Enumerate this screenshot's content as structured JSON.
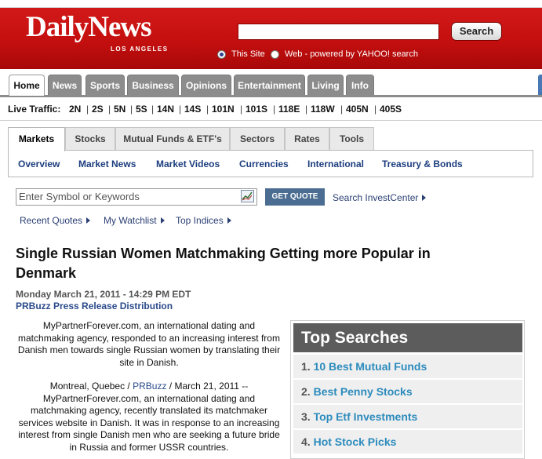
{
  "header": {
    "logo": "DailyNews",
    "logo_sub": "LOS ANGELES",
    "search_value": "",
    "search_button": "Search",
    "radio_this_site": "This Site",
    "radio_web": "Web - powered by YAHOO! search"
  },
  "nav": {
    "tabs": [
      "Home",
      "News",
      "Sports",
      "Business",
      "Opinions",
      "Entertainment",
      "Living",
      "Info"
    ],
    "active": "Home"
  },
  "traffic": {
    "label": "Live Traffic:",
    "items": [
      "2N",
      "2S",
      "5N",
      "5S",
      "14N",
      "14S",
      "101N",
      "101S",
      "118E",
      "118W",
      "405N",
      "405S"
    ]
  },
  "markets": {
    "tabs": [
      "Markets",
      "Stocks",
      "Mutual Funds & ETF's",
      "Sectors",
      "Rates",
      "Tools"
    ],
    "active": "Markets",
    "sub_links": [
      "Overview",
      "Market News",
      "Market Videos",
      "Currencies",
      "International",
      "Treasury & Bonds"
    ],
    "symbol_placeholder": "Enter Symbol or Keywords",
    "get_quote": "GET QUOTE",
    "investcenter": "Search InvestCenter",
    "quick_links": [
      "Recent Quotes",
      "My Watchlist",
      "Top Indices"
    ]
  },
  "article": {
    "headline": "Single Russian Women Matchmaking Getting more Popular in Denmark",
    "dateline": "Monday March 21, 2011 - 14:29 PM EDT",
    "source": "PRBuzz Press Release Distribution",
    "para1": "MyPartnerForever.com, an international dating and matchmaking agency, responded to an increasing interest from Danish men towards single Russian women by translating their site in Danish.",
    "para2_before": "Montreal, Quebec  / ",
    "para2_link": "PRBuzz",
    "para2_after": " / March 21, 2011 -- MyPartnerForever.com, an international dating and matchmaking agency, recently translated its matchmaker services website in Danish. It was in response to an increasing interest from single Danish men who are seeking a future bride in Russia and former USSR countries."
  },
  "top_searches": {
    "title": "Top Searches",
    "items": [
      {
        "num": "1.",
        "label": "10 Best Mutual Funds"
      },
      {
        "num": "2.",
        "label": "Best Penny Stocks"
      },
      {
        "num": "3.",
        "label": "Top Etf Investments"
      },
      {
        "num": "4.",
        "label": "Hot Stock Picks"
      }
    ]
  },
  "colors": {
    "header_red": "#c40f0f",
    "nav_gray": "#8c8c8c",
    "link_blue": "#1c3d7e",
    "top_search_link": "#2c8bbd",
    "get_quote_bg": "#4a6d91"
  }
}
